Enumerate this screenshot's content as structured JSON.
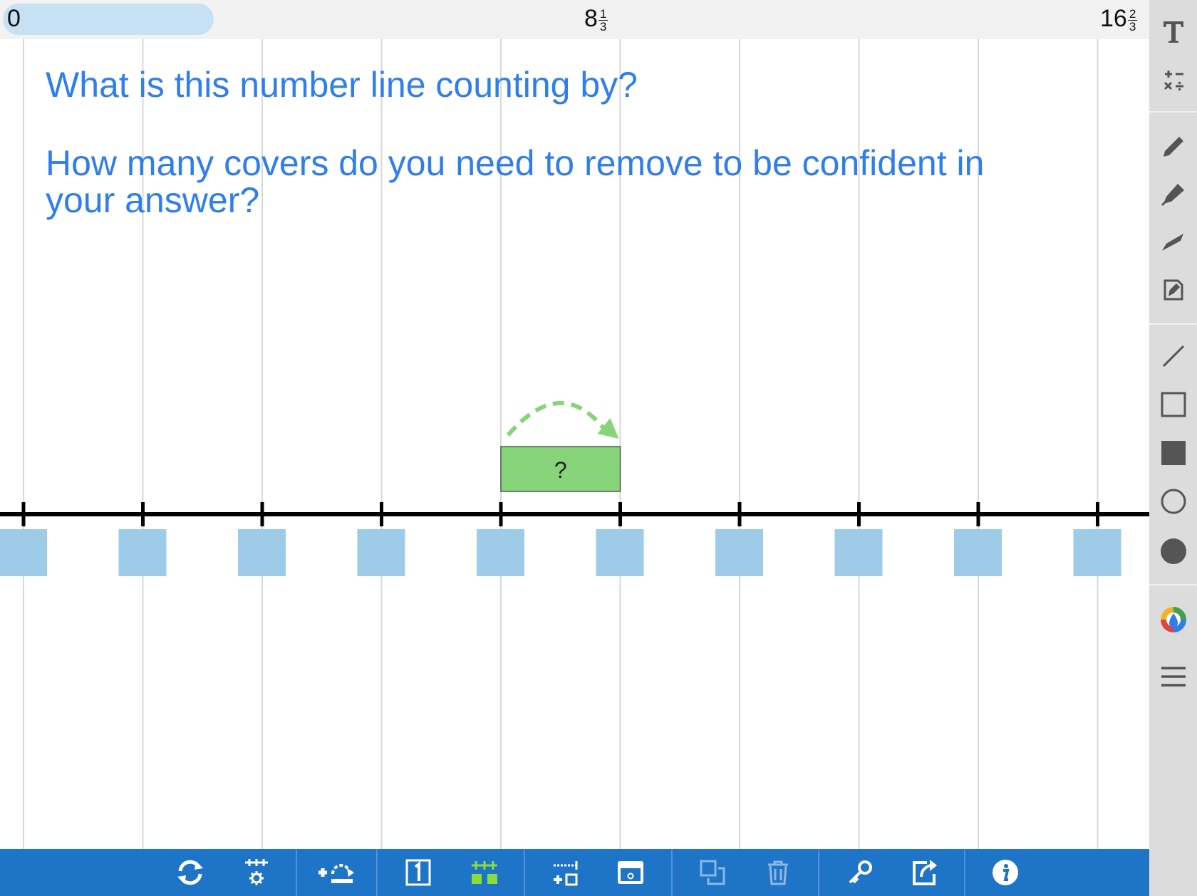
{
  "axis": {
    "start_label": "0",
    "mid": {
      "whole": "8",
      "num": "1",
      "den": "3"
    },
    "end": {
      "whole": "16",
      "num": "2",
      "den": "3"
    }
  },
  "questions": {
    "line1": "What is this number line counting by?",
    "line2a": "How many covers do you need to remove to be confident in",
    "line2b": "your answer?"
  },
  "number_line": {
    "tick_count": 10,
    "covers_count": 10,
    "jump_label": "?",
    "jump_from_tick": 4,
    "jump_to_tick": 5
  },
  "colors": {
    "question_text": "#2f7ef0",
    "cover": "#9dcbe8",
    "jump_box": "#88d47a",
    "jump_arrow": "#88d47a",
    "toolbar_bottom": "#1e74c7",
    "toolbar_right": "#dcdcdc",
    "active_tool": "#8bdc3c"
  },
  "right_tools": [
    "text-icon",
    "math-operations-icon",
    "pen-icon",
    "highlighter-icon",
    "eraser-icon",
    "edit-note-icon",
    "line-icon",
    "rectangle-outline-icon",
    "rectangle-filled-icon",
    "circle-outline-icon",
    "circle-filled-icon",
    "color-picker-icon",
    "menu-icon"
  ],
  "bottom_tools": [
    "refresh-icon",
    "settings-icon",
    "add-jump-icon",
    "number-label-icon",
    "covers-icon",
    "add-tick-icon",
    "cover-tool-icon",
    "duplicate-icon",
    "trash-icon",
    "key-icon",
    "share-icon",
    "info-icon"
  ]
}
